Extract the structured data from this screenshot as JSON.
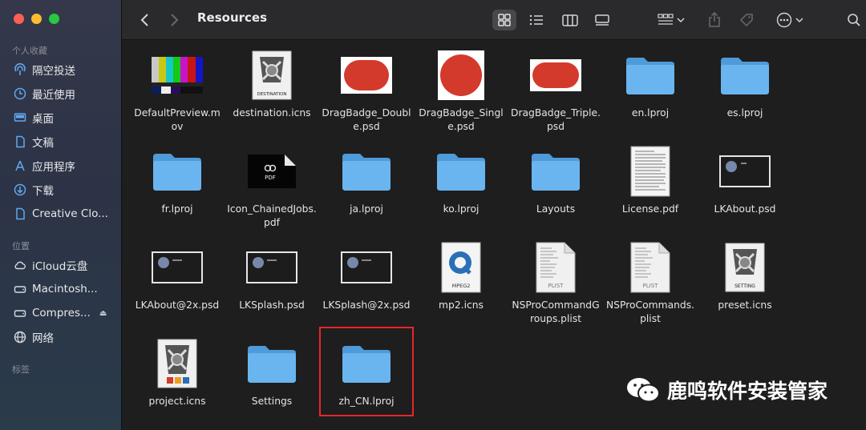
{
  "window": {
    "title": "Resources"
  },
  "sidebar": {
    "sections": [
      {
        "label": "个人收藏",
        "items": [
          {
            "label": "隔空投送",
            "icon": "airdrop-icon"
          },
          {
            "label": "最近使用",
            "icon": "clock-icon"
          },
          {
            "label": "桌面",
            "icon": "desktop-icon"
          },
          {
            "label": "文稿",
            "icon": "document-icon"
          },
          {
            "label": "应用程序",
            "icon": "applications-icon"
          },
          {
            "label": "下载",
            "icon": "download-icon"
          },
          {
            "label": "Creative Clo...",
            "icon": "document-icon"
          }
        ]
      },
      {
        "label": "位置",
        "items": [
          {
            "label": "iCloud云盘",
            "icon": "cloud-icon"
          },
          {
            "label": "Macintosh...",
            "icon": "disk-icon"
          },
          {
            "label": "Compres...",
            "icon": "disk-icon"
          },
          {
            "label": "网络",
            "icon": "globe-icon"
          }
        ]
      },
      {
        "label": "标签",
        "items": []
      }
    ]
  },
  "files": [
    {
      "name": "DefaultPreview.mov",
      "type": "video"
    },
    {
      "name": "destination.icns",
      "type": "icns-destination",
      "badge": "DESTINATION"
    },
    {
      "name": "DragBadge_Double.psd",
      "type": "badge-double"
    },
    {
      "name": "DragBadge_Single.psd",
      "type": "badge-single"
    },
    {
      "name": "DragBadge_Triple.psd",
      "type": "badge-triple"
    },
    {
      "name": "en.lproj",
      "type": "folder"
    },
    {
      "name": "es.lproj",
      "type": "folder"
    },
    {
      "name": "fr.lproj",
      "type": "folder"
    },
    {
      "name": "Icon_ChainedJobs.pdf",
      "type": "pdf-dark",
      "badge": "PDF"
    },
    {
      "name": "ja.lproj",
      "type": "folder"
    },
    {
      "name": "ko.lproj",
      "type": "folder"
    },
    {
      "name": "Layouts",
      "type": "folder"
    },
    {
      "name": "License.pdf",
      "type": "pdf-doc"
    },
    {
      "name": "LKAbout.psd",
      "type": "screen"
    },
    {
      "name": "LKAbout@2x.psd",
      "type": "screen"
    },
    {
      "name": "LKSplash.psd",
      "type": "screen"
    },
    {
      "name": "LKSplash@2x.psd",
      "type": "screen"
    },
    {
      "name": "mp2.icns",
      "type": "mpeg",
      "badge": "MPEG2"
    },
    {
      "name": "NSProCommandGroups.plist",
      "type": "plist",
      "badge": "PLIST"
    },
    {
      "name": "NSProCommands.plist",
      "type": "plist",
      "badge": "PLIST"
    },
    {
      "name": "preset.icns",
      "type": "icns-setting",
      "badge": "SETTING"
    },
    {
      "name": "project.icns",
      "type": "icns-project"
    },
    {
      "name": "Settings",
      "type": "folder"
    },
    {
      "name": "zh_CN.lproj",
      "type": "folder"
    }
  ],
  "watermark": {
    "text": "鹿鸣软件安装管家"
  },
  "colors": {
    "accent": "#e8262b",
    "folder": "#5aa9e6",
    "badge_red": "#d43a2c"
  }
}
